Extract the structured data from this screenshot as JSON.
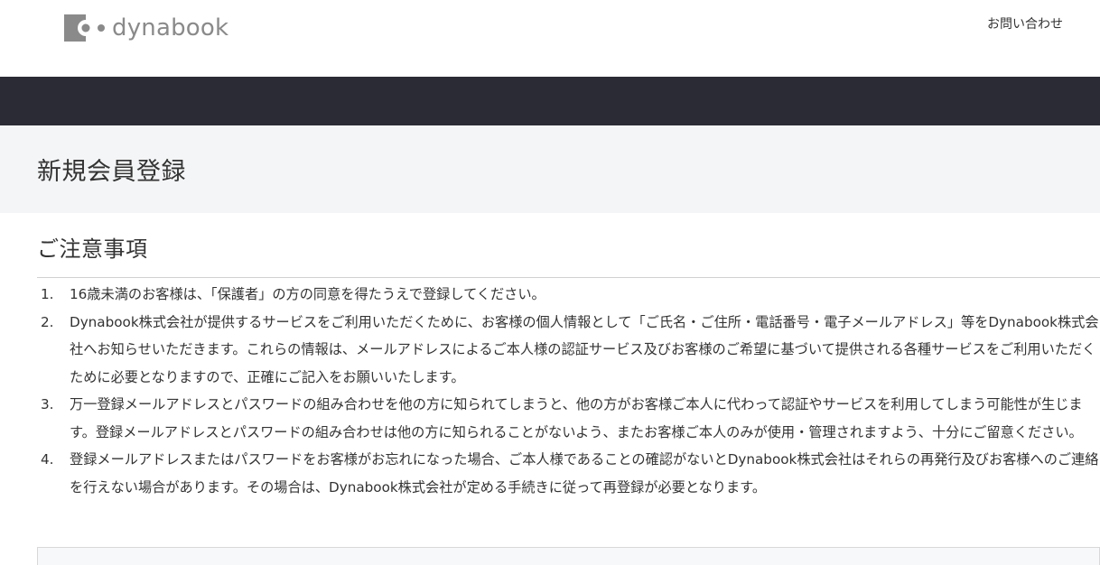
{
  "header": {
    "logo_text": "dynabook",
    "contact_link": "お問い合わせ"
  },
  "colors": {
    "navbar": "#2b2b35",
    "title_band": "#f4f5f6",
    "logo_gray": "#8a8a8a",
    "text": "#333333"
  },
  "page": {
    "title": "新規会員登録",
    "section_title": "ご注意事項"
  },
  "notes": [
    {
      "num": "1.",
      "text": "16歳未満のお客様は、「保護者」の方の同意を得たうえで登録してください。"
    },
    {
      "num": "2.",
      "text": "Dynabook株式会社が提供するサービスをご利用いただくために、お客様の個人情報として「ご氏名・ご住所・電話番号・電子メールアドレス」等をDynabook株式会社へお知らせいただきます。これらの情報は、メールアドレスによるご本人様の認証サービス及びお客様のご希望に基づいて提供される各種サービスをご利用いただくために必要となりますので、正確にご記入をお願いいたします。"
    },
    {
      "num": "3.",
      "text": "万一登録メールアドレスとパスワードの組み合わせを他の方に知られてしまうと、他の方がお客様ご本人に代わって認証やサービスを利用してしまう可能性が生じます。登録メールアドレスとパスワードの組み合わせは他の方に知られることがないよう、またお客様ご本人のみが使用・管理されますよう、十分にご留意ください。"
    },
    {
      "num": "4.",
      "text": "登録メールアドレスまたはパスワードをお客様がお忘れになった場合、ご本人様であることの確認がないとDynabook株式会社はそれらの再発行及びお客様へのご連絡を行えない場合があります。その場合は、Dynabook株式会社が定める手続きに従って再登録が必要となります。"
    }
  ]
}
